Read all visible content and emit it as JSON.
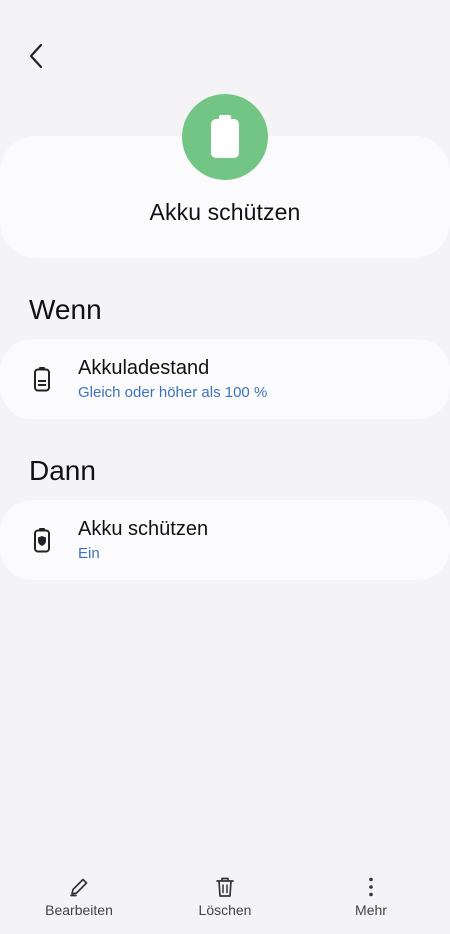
{
  "header": {
    "back_icon": "chevron-left-icon"
  },
  "hero": {
    "icon": "battery-icon",
    "title": "Akku schützen",
    "accent": "#72c584"
  },
  "sections": [
    {
      "title": "Wenn",
      "card": {
        "icon": "battery-level-icon",
        "title": "Akkuladestand",
        "subtitle": "Gleich oder höher als 100 %"
      }
    },
    {
      "title": "Dann",
      "card": {
        "icon": "battery-shield-icon",
        "title": "Akku schützen",
        "subtitle": "Ein"
      }
    }
  ],
  "bottom_bar": {
    "edit_label": "Bearbeiten",
    "delete_label": "Löschen",
    "more_label": "Mehr"
  },
  "colors": {
    "link": "#3b73bb",
    "background": "#f4f4f6",
    "card": "#fbfbfd"
  }
}
